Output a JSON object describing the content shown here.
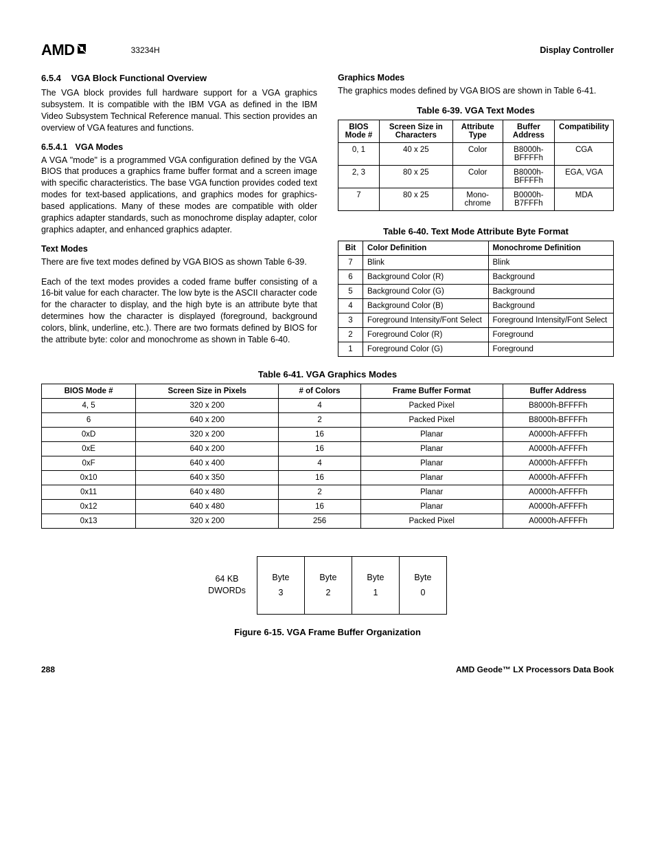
{
  "header": {
    "logo_text": "AMD",
    "doc_number": "33234H",
    "right_title": "Display Controller"
  },
  "left_col": {
    "sec_num": "6.5.4",
    "sec_title": "VGA Block Functional Overview",
    "para1": "The VGA block provides full hardware support for a VGA graphics subsystem. It is compatible with the IBM VGA as defined in the IBM Video Subsystem Technical Reference manual. This section provides an overview of VGA features and functions.",
    "sub_num": "6.5.4.1",
    "sub_title": "VGA Modes",
    "para2": "A VGA \"mode\" is a programmed VGA configuration defined by the VGA BIOS that produces a graphics frame buffer format and a screen image with specific characteristics. The base VGA function provides coded text modes for text-based applications, and graphics modes for graphics-based applications. Many of these modes are compatible with older graphics adapter standards, such as monochrome display adapter, color graphics adapter, and enhanced graphics adapter.",
    "tm_head": "Text Modes",
    "para3": "There are five text modes defined by VGA BIOS as shown Table 6-39.",
    "para4": "Each of the text modes provides a coded frame buffer consisting of a 16-bit value for each character. The low byte is the ASCII character code for the character to display, and the high byte is an attribute byte that determines how the character is displayed (foreground, background colors, blink, underline, etc.). There are two formats defined by BIOS for the attribute byte: color and monochrome as shown in Table 6-40."
  },
  "right_col": {
    "gm_head": "Graphics Modes",
    "gm_para": "The graphics modes defined by VGA BIOS are shown in Table 6-41."
  },
  "table39": {
    "caption": "Table 6-39.  VGA Text Modes",
    "headers": [
      "BIOS Mode #",
      "Screen Size in Characters",
      "Attribute Type",
      "Buffer Address",
      "Compatibility"
    ],
    "rows": [
      [
        "0, 1",
        "40 x 25",
        "Color",
        "B8000h-BFFFFh",
        "CGA"
      ],
      [
        "2, 3",
        "80 x 25",
        "Color",
        "B8000h-BFFFFh",
        "EGA, VGA"
      ],
      [
        "7",
        "80 x 25",
        "Mono-chrome",
        "B0000h-B7FFFh",
        "MDA"
      ]
    ]
  },
  "table40": {
    "caption": "Table 6-40.  Text Mode Attribute Byte Format",
    "headers": [
      "Bit",
      "Color Definition",
      "Monochrome Definition"
    ],
    "rows": [
      [
        "7",
        "Blink",
        "Blink"
      ],
      [
        "6",
        "Background Color (R)",
        "Background"
      ],
      [
        "5",
        "Background Color (G)",
        "Background"
      ],
      [
        "4",
        "Background Color (B)",
        "Background"
      ],
      [
        "3",
        "Foreground Intensity/Font Select",
        "Foreground Intensity/Font Select"
      ],
      [
        "2",
        "Foreground Color (R)",
        "Foreground"
      ],
      [
        "1",
        "Foreground Color (G)",
        "Foreground"
      ]
    ]
  },
  "table41": {
    "caption": "Table 6-41.  VGA Graphics Modes",
    "headers": [
      "BIOS Mode #",
      "Screen Size in Pixels",
      "# of Colors",
      "Frame Buffer Format",
      "Buffer Address"
    ],
    "rows": [
      [
        "4, 5",
        "320 x 200",
        "4",
        "Packed Pixel",
        "B8000h-BFFFFh"
      ],
      [
        "6",
        "640 x 200",
        "2",
        "Packed Pixel",
        "B8000h-BFFFFh"
      ],
      [
        "0xD",
        "320 x 200",
        "16",
        "Planar",
        "A0000h-AFFFFh"
      ],
      [
        "0xE",
        "640 x 200",
        "16",
        "Planar",
        "A0000h-AFFFFh"
      ],
      [
        "0xF",
        "640 x 400",
        "4",
        "Planar",
        "A0000h-AFFFFh"
      ],
      [
        "0x10",
        "640 x 350",
        "16",
        "Planar",
        "A0000h-AFFFFh"
      ],
      [
        "0x11",
        "640 x 480",
        "2",
        "Planar",
        "A0000h-AFFFFh"
      ],
      [
        "0x12",
        "640 x 480",
        "16",
        "Planar",
        "A0000h-AFFFFh"
      ],
      [
        "0x13",
        "320 x 200",
        "256",
        "Packed Pixel",
        "A0000h-AFFFFh"
      ]
    ]
  },
  "figure": {
    "label_line1": "64 KB",
    "label_line2": "DWORDs",
    "boxes": [
      {
        "top": "Byte",
        "bottom": "3"
      },
      {
        "top": "Byte",
        "bottom": "2"
      },
      {
        "top": "Byte",
        "bottom": "1"
      },
      {
        "top": "Byte",
        "bottom": "0"
      }
    ],
    "caption": "Figure 6-15.  VGA Frame Buffer Organization"
  },
  "footer": {
    "page": "288",
    "title": "AMD Geode™ LX Processors Data Book"
  }
}
